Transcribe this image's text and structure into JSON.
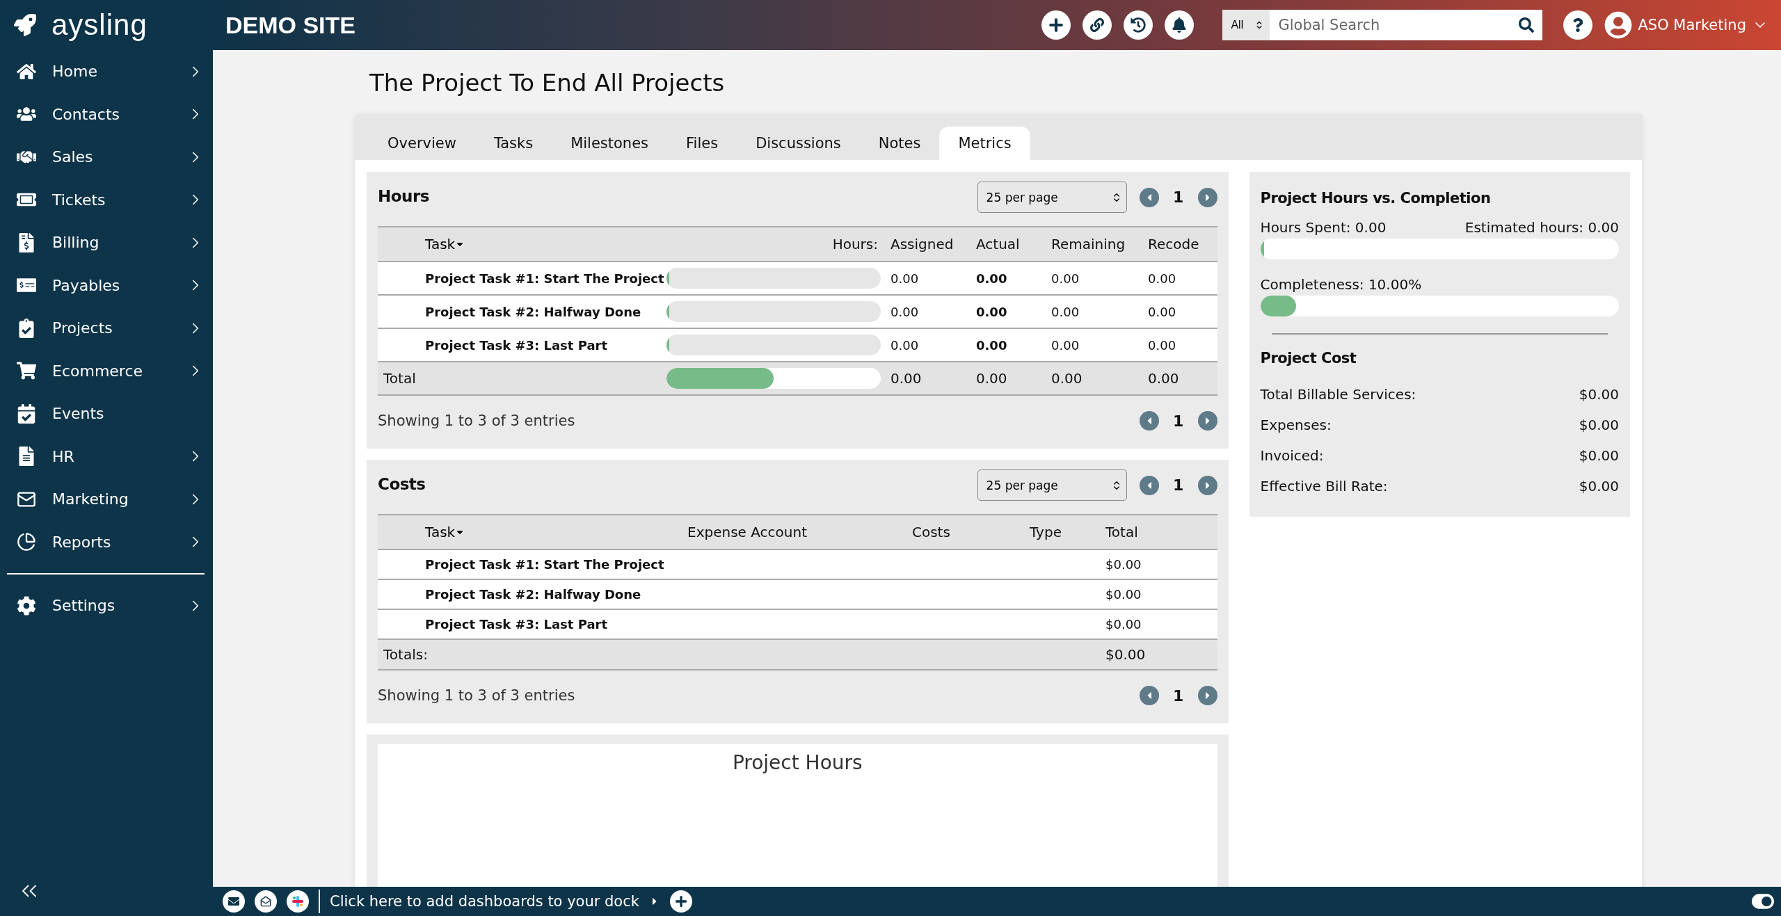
{
  "sidebar": {
    "logo": "aysling",
    "items": [
      {
        "label": "Home",
        "has_submenu": true
      },
      {
        "label": "Contacts",
        "has_submenu": true
      },
      {
        "label": "Sales",
        "has_submenu": true
      },
      {
        "label": "Tickets",
        "has_submenu": true
      },
      {
        "label": "Billing",
        "has_submenu": true
      },
      {
        "label": "Payables",
        "has_submenu": true
      },
      {
        "label": "Projects",
        "has_submenu": true
      },
      {
        "label": "Ecommerce",
        "has_submenu": true
      },
      {
        "label": "Events",
        "has_submenu": false
      },
      {
        "label": "HR",
        "has_submenu": true
      },
      {
        "label": "Marketing",
        "has_submenu": true
      },
      {
        "label": "Reports",
        "has_submenu": true
      }
    ],
    "settings": {
      "label": "Settings",
      "has_submenu": true
    }
  },
  "topbar": {
    "site": "DEMO SITE",
    "search": {
      "scope": "All",
      "placeholder": "Global Search"
    },
    "user": "ASO Marketing"
  },
  "page_title": "The Project To End All Projects",
  "tabs": [
    {
      "label": "Overview",
      "selected": false
    },
    {
      "label": "Tasks",
      "selected": false
    },
    {
      "label": "Milestones",
      "selected": false
    },
    {
      "label": "Files",
      "selected": false
    },
    {
      "label": "Discussions",
      "selected": false
    },
    {
      "label": "Notes",
      "selected": false
    },
    {
      "label": "Metrics",
      "selected": true
    }
  ],
  "hours": {
    "title": "Hours",
    "per_page": "25 per page",
    "page": "1",
    "columns": [
      "Task",
      "Hours:",
      "Assigned",
      "Actual",
      "Remaining",
      "Recode"
    ],
    "rows": [
      {
        "task": "Project Task #1: Start The Project",
        "level": 0.01,
        "assigned": "0.00",
        "actual": "0.00",
        "remaining": "0.00",
        "recode": "0.00"
      },
      {
        "task": "Project Task #2: Halfway Done",
        "level": 0.01,
        "assigned": "0.00",
        "actual": "0.00",
        "remaining": "0.00",
        "recode": "0.00"
      },
      {
        "task": "Project Task #3: Last Part",
        "level": 0.01,
        "assigned": "0.00",
        "actual": "0.00",
        "remaining": "0.00",
        "recode": "0.00"
      }
    ],
    "total": {
      "label": "Total",
      "level": 0.5,
      "assigned": "0.00",
      "actual": "0.00",
      "remaining": "0.00",
      "recode": "0.00"
    },
    "footer": "Showing 1 to 3 of 3 entries",
    "footer_page": "1"
  },
  "costs": {
    "title": "Costs",
    "per_page": "25 per page",
    "page": "1",
    "columns": [
      "Task",
      "Expense Account",
      "Costs",
      "Type",
      "Total"
    ],
    "rows": [
      {
        "task": "Project Task #1: Start The Project",
        "total": "$0.00"
      },
      {
        "task": "Project Task #2: Halfway Done",
        "total": "$0.00"
      },
      {
        "task": "Project Task #3: Last Part",
        "total": "$0.00"
      }
    ],
    "totals": {
      "label": "Totals:",
      "total": "$0.00"
    },
    "footer": "Showing 1 to 3 of 3 entries",
    "footer_page": "1"
  },
  "hours_chart": {
    "title": "Project Hours"
  },
  "summary": {
    "title": "Project Hours vs. Completion",
    "hours_spent": "Hours Spent: 0.00",
    "estimated": "Estimated hours: 0.00",
    "hours_bar": {
      "level": 0.01
    },
    "completeness": "Completeness: 10.00%",
    "completeness_bar": {
      "level": 0.1
    },
    "cost_title": "Project Cost",
    "cost_rows": [
      {
        "label": "Total Billable Services:",
        "value": "$0.00"
      },
      {
        "label": "Expenses:",
        "value": "$0.00"
      },
      {
        "label": "Invoiced:",
        "value": "$0.00"
      },
      {
        "label": "Effective Bill Rate:",
        "value": "$0.00"
      }
    ]
  },
  "dock": {
    "text": "Click here to add dashboards to your dock"
  }
}
